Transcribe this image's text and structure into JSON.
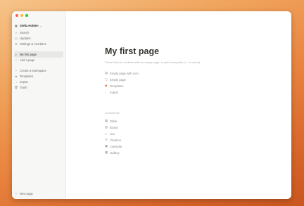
{
  "colors": {
    "close": "#ff5f57",
    "minimize": "#febc2e",
    "maximize": "#28c840",
    "accent": "#e16f3c"
  },
  "sidebar": {
    "workspace": "Stella Holden",
    "items": [
      {
        "label": "Search",
        "icon": "search-icon"
      },
      {
        "label": "Updates",
        "icon": "clock-icon"
      },
      {
        "label": "Settings & members",
        "icon": "gear-icon"
      }
    ],
    "pages": [
      {
        "label": "My first page",
        "icon": "page-icon"
      },
      {
        "label": "Add a page",
        "icon": "plus-icon"
      }
    ],
    "tools": [
      {
        "label": "Create a teamspace",
        "icon": "plus-icon"
      },
      {
        "label": "Templates",
        "icon": "template-icon"
      },
      {
        "label": "Import",
        "icon": "download-icon"
      },
      {
        "label": "Trash",
        "icon": "trash-icon"
      }
    ],
    "new_page": "New page"
  },
  "main": {
    "title": "My first page",
    "hint": "Press Enter to continue with an empty page, or pick a template (↑↓ to select)",
    "options": [
      {
        "label": "Empty page with icon",
        "icon": "page-icon"
      },
      {
        "label": "Empty page",
        "icon": "page-icon"
      },
      {
        "label": "Templates",
        "icon": "template-icon"
      },
      {
        "label": "Import",
        "icon": "download-icon"
      }
    ],
    "section_label": "DATABASE",
    "databases": [
      {
        "label": "Table",
        "icon": "table-icon"
      },
      {
        "label": "Board",
        "icon": "board-icon"
      },
      {
        "label": "List",
        "icon": "list-icon"
      },
      {
        "label": "Timeline",
        "icon": "timeline-icon"
      },
      {
        "label": "Calendar",
        "icon": "calendar-icon"
      },
      {
        "label": "Gallery",
        "icon": "gallery-icon"
      }
    ]
  }
}
